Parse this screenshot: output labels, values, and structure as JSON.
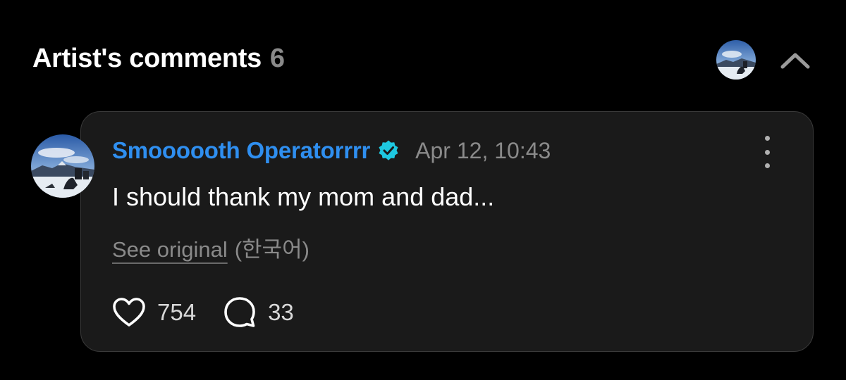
{
  "header": {
    "title": "Artist's comments",
    "count": "6"
  },
  "comment": {
    "author": "Smoooooth Operatorrrr",
    "verified": true,
    "timestamp": "Apr 12, 10:43",
    "text": "I should thank my mom and dad...",
    "see_original_label": "See original",
    "original_language": "(한국어)",
    "likes": "754",
    "replies": "33"
  },
  "colors": {
    "background": "#000000",
    "card_background": "#1a1a1a",
    "author_name": "#2f8ff0",
    "verified_badge": "#1ec8e0",
    "muted_text": "#8a8a8a"
  },
  "icons": {
    "collapse": "chevron-up-icon",
    "verified": "verified-badge-icon",
    "more": "more-vertical-icon",
    "like": "heart-icon",
    "reply": "speech-bubble-icon"
  }
}
